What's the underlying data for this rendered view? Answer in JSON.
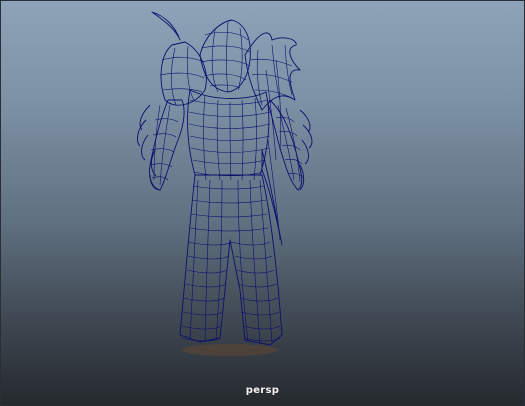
{
  "viewport": {
    "camera_name": "persp",
    "wire_color": "#0b0f6e",
    "shadow_color": "#6b4a2c"
  }
}
